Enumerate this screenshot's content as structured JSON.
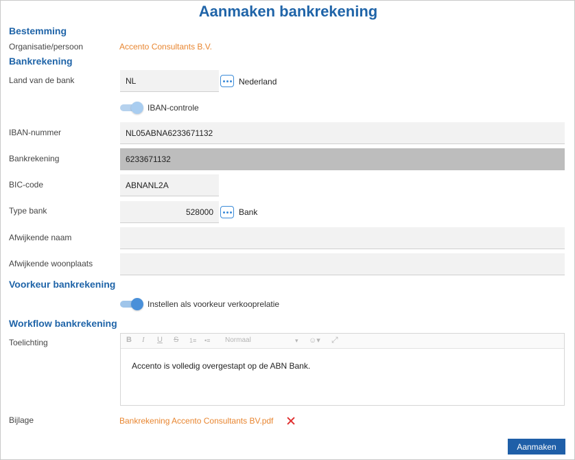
{
  "title": "Aanmaken bankrekening",
  "sections": {
    "bestemming": "Bestemming",
    "bankrekening": "Bankrekening",
    "voorkeur": "Voorkeur bankrekening",
    "workflow": "Workflow bankrekening"
  },
  "bestemming": {
    "org_label": "Organisatie/persoon",
    "org_value": "Accento Consultants B.V."
  },
  "bank": {
    "land_label": "Land van de bank",
    "land_value": "NL",
    "land_name": "Nederland",
    "iban_check_label": "IBAN-controle",
    "iban_label": "IBAN-nummer",
    "iban_value": "NL05ABNA6233671132",
    "rekening_label": "Bankrekening",
    "rekening_value": "6233671132",
    "bic_label": "BIC-code",
    "bic_value": "ABNANL2A",
    "type_label": "Type bank",
    "type_value": "528000",
    "type_name": "Bank",
    "afw_naam_label": "Afwijkende naam",
    "afw_naam_value": "",
    "afw_woonplaats_label": "Afwijkende woonplaats",
    "afw_woonplaats_value": ""
  },
  "voorkeur": {
    "toggle_label": "Instellen als voorkeur verkooprelatie"
  },
  "workflow": {
    "toelichting_label": "Toelichting",
    "toolbar": {
      "bold": "B",
      "italic": "I",
      "underline": "U",
      "strike": "S",
      "ordered_list": "1≡",
      "bullet_list": "•≡",
      "format": "Normaal",
      "format_caret": "▾",
      "emoji": "☺▾",
      "fullscreen": "⤢"
    },
    "toelichting_value": "Accento is volledig overgestapt op de ABN Bank.",
    "bijlage_label": "Bijlage",
    "bijlage_file": "Bankrekening Accento Consultants BV.pdf"
  },
  "actions": {
    "submit": "Aanmaken"
  },
  "colors": {
    "accent": "#1f64a8",
    "link": "#e8852f",
    "delete": "#e03030",
    "button": "#1f5fa8"
  },
  "icons": {
    "lookup": "ellipsis-icon",
    "delete": "close-icon"
  },
  "toggles": {
    "iban_check": true,
    "voorkeur_verkooprelatie": true
  }
}
